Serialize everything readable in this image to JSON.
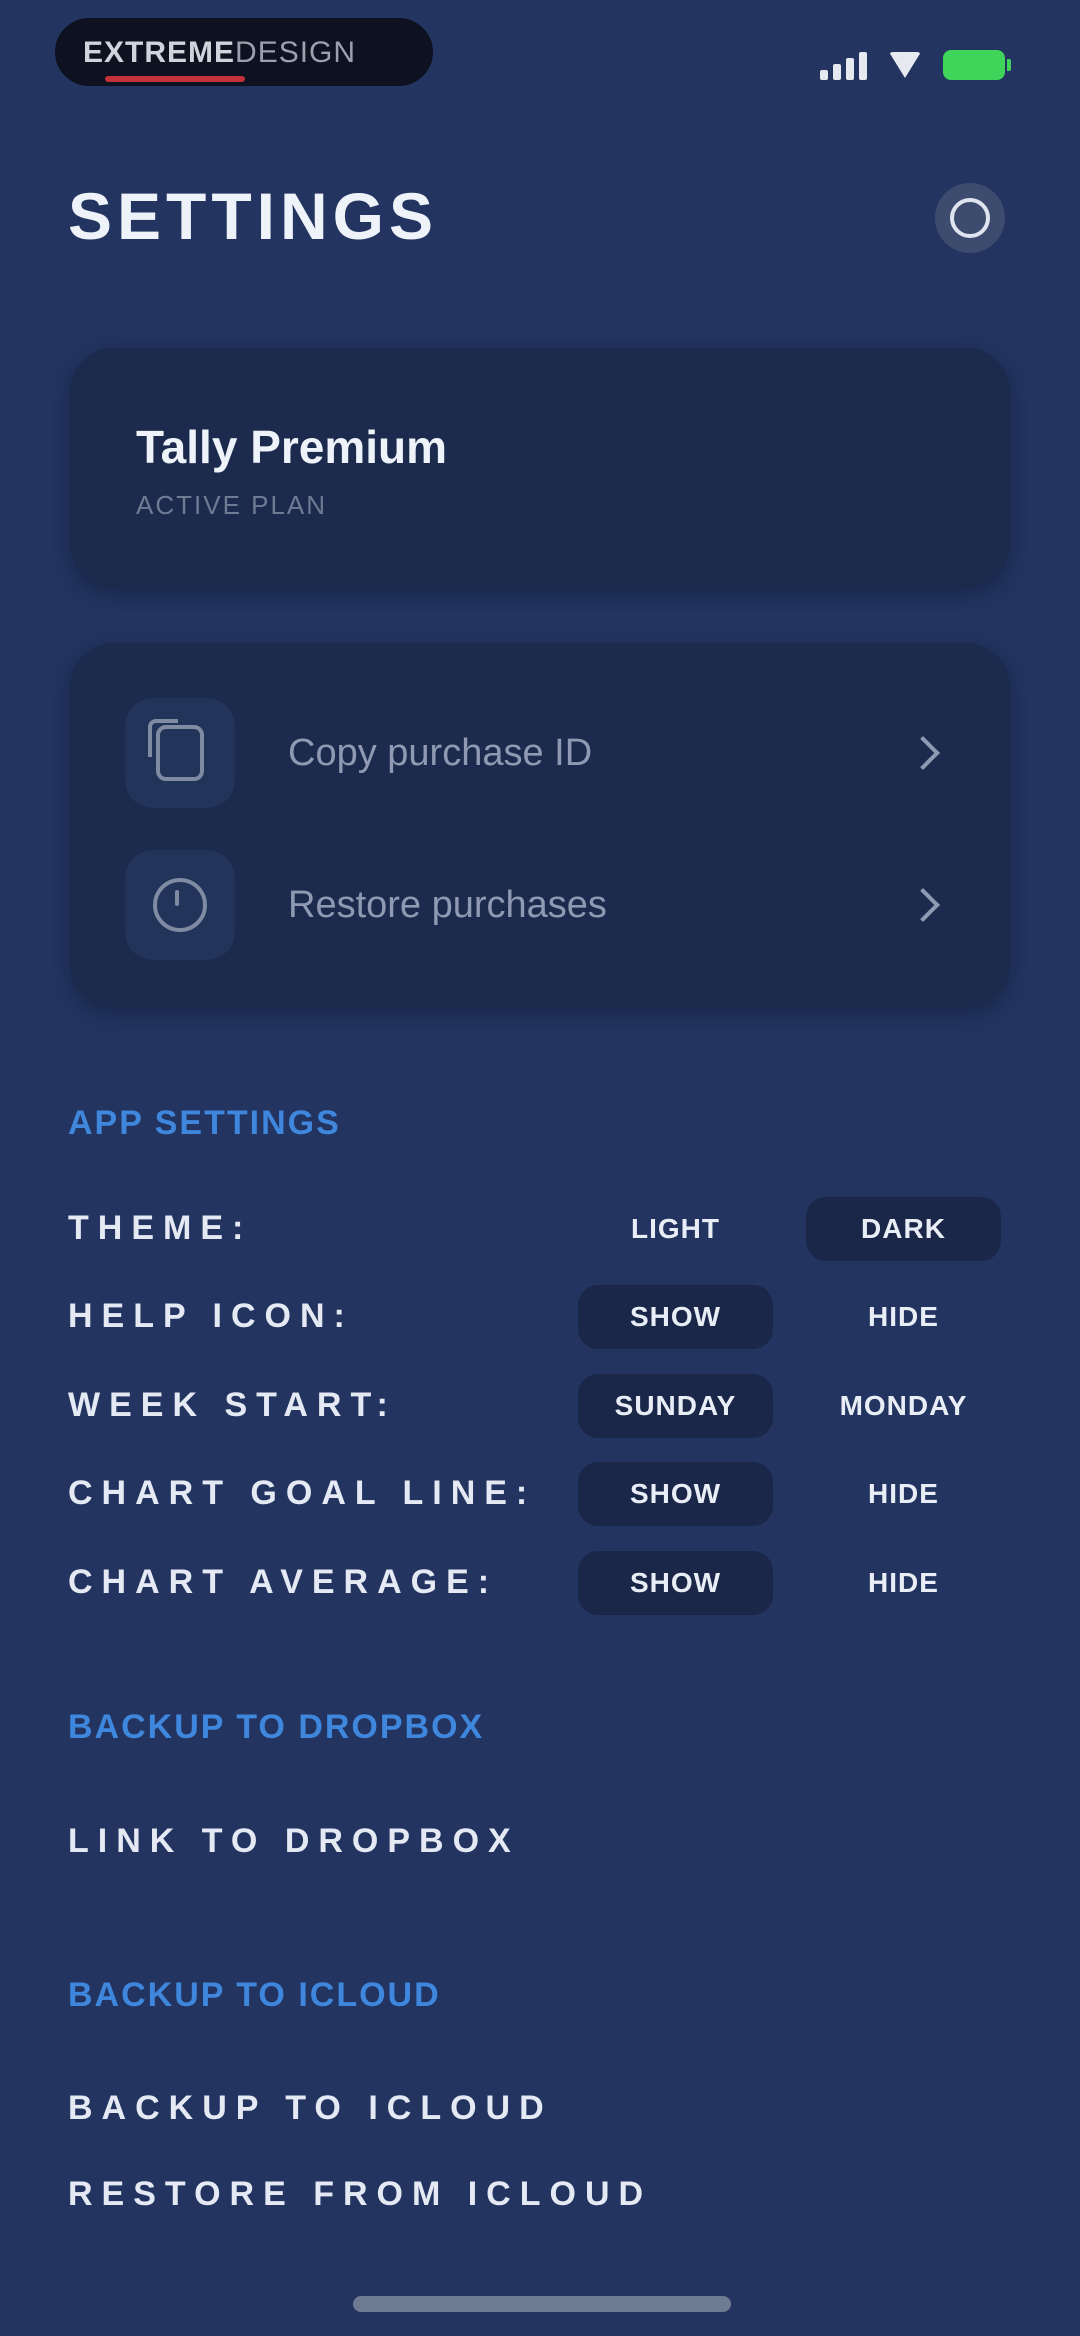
{
  "status_bar": {
    "logo_bold": "EXTREME",
    "logo_light": "DESIGN",
    "icons": [
      "signal-icon",
      "wifi-icon",
      "battery-icon"
    ],
    "battery_color": "#3fd45a"
  },
  "header": {
    "title": "SETTINGS",
    "help_icon": "help-circle-icon"
  },
  "premium": {
    "title": "Tally Premium",
    "subtitle": "ACTIVE PLAN"
  },
  "purchase_actions": [
    {
      "label": "Copy purchase ID",
      "icon": "copy-icon"
    },
    {
      "label": "Restore purchases",
      "icon": "restore-icon"
    }
  ],
  "app_settings": {
    "header": "APP SETTINGS",
    "rows": [
      {
        "label": "THEME:",
        "options": [
          "LIGHT",
          "DARK"
        ],
        "selected": "DARK"
      },
      {
        "label": "HELP ICON:",
        "options": [
          "SHOW",
          "HIDE"
        ],
        "selected": "SHOW"
      },
      {
        "label": "WEEK START:",
        "options": [
          "SUNDAY",
          "MONDAY"
        ],
        "selected": "SUNDAY"
      },
      {
        "label": "CHART GOAL LINE:",
        "options": [
          "SHOW",
          "HIDE"
        ],
        "selected": "SHOW"
      },
      {
        "label": "CHART AVERAGE:",
        "options": [
          "SHOW",
          "HIDE"
        ],
        "selected": "SHOW"
      }
    ]
  },
  "dropbox": {
    "header": "BACKUP TO DROPBOX",
    "link_label": "LINK TO DROPBOX"
  },
  "icloud": {
    "header": "BACKUP TO ICLOUD",
    "backup_label": "BACKUP TO ICLOUD",
    "restore_label": "RESTORE FROM ICLOUD"
  },
  "colors": {
    "background": "#22345f",
    "card": "#1b2a4d",
    "accent": "#3f86dd"
  }
}
